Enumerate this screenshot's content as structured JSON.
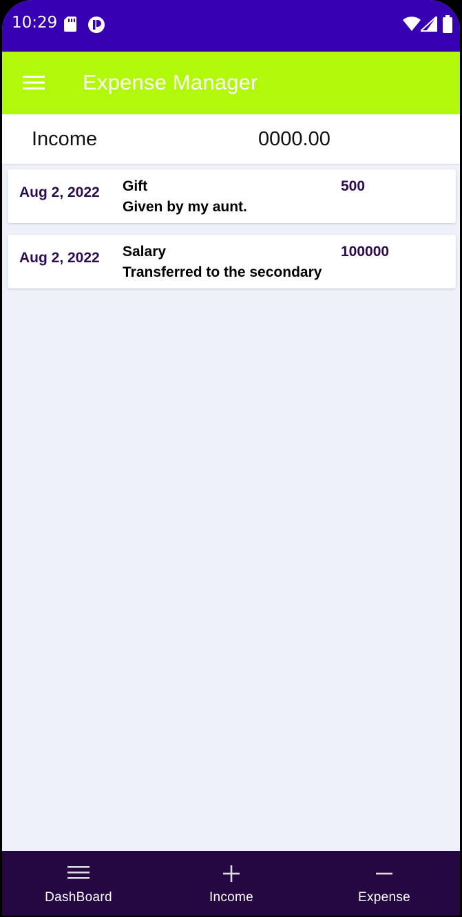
{
  "status_bar": {
    "time": "10:29",
    "icons": [
      "sd-card-icon",
      "p-icon",
      "wifi-icon",
      "signal-icon",
      "battery-icon"
    ]
  },
  "app_bar": {
    "title": "Expense Manager",
    "menu_icon": "hamburger-menu-icon",
    "background": "#b1f80b"
  },
  "summary": {
    "label": "Income",
    "total": "0000.00"
  },
  "entries": [
    {
      "date": "Aug 2, 2022",
      "title": "Gift",
      "description": "Given by my aunt.",
      "amount": "500"
    },
    {
      "date": "Aug 2, 2022",
      "title": "Salary",
      "description": "Transferred to the secondary",
      "amount": "100000"
    }
  ],
  "bottom_nav": {
    "items": [
      {
        "label": "DashBoard",
        "icon": "list-icon"
      },
      {
        "label": "Income",
        "icon": "plus-icon"
      },
      {
        "label": "Expense",
        "icon": "minus-icon"
      }
    ],
    "background": "#250842"
  },
  "colors": {
    "status_bar": "#3800b3",
    "accent_text": "#2d0b4d",
    "list_background": "#eef1f9"
  }
}
